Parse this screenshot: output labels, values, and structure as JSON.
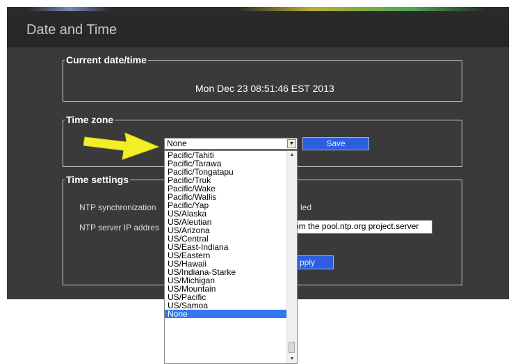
{
  "header": {
    "title": "Date and Time"
  },
  "current": {
    "legend": "Current date/time",
    "value": "Mon Dec 23 08:51:46 EST 2013"
  },
  "timezone": {
    "legend": "Time zone",
    "selected": "None",
    "save_label": "Save",
    "options": [
      "Pacific/Tahiti",
      "Pacific/Tarawa",
      "Pacific/Tongatapu",
      "Pacific/Truk",
      "Pacific/Wake",
      "Pacific/Wallis",
      "Pacific/Yap",
      "US/Alaska",
      "US/Aleutian",
      "US/Arizona",
      "US/Central",
      "US/East-Indiana",
      "US/Eastern",
      "US/Hawaii",
      "US/Indiana-Starke",
      "US/Michigan",
      "US/Mountain",
      "US/Pacific",
      "US/Samoa",
      "None"
    ],
    "highlighted": "None"
  },
  "settings": {
    "legend": "Time settings",
    "ntp_sync_label": "NTP synchronization",
    "ntp_sync_value_fragment": "led",
    "ntp_server_label": "NTP server IP addres",
    "ntp_server_value": "om the pool.ntp.org project.server",
    "apply_fragment": "pply"
  },
  "colors": {
    "accent": "#2c5fe0",
    "panel": "#3a3a3a",
    "highlight": "#3377ee",
    "pointer_arrow": "#f2ee2a"
  },
  "icons": {
    "pointer": "yellow-arrow-icon",
    "dropdown_arrow": "chevron-down-icon"
  }
}
